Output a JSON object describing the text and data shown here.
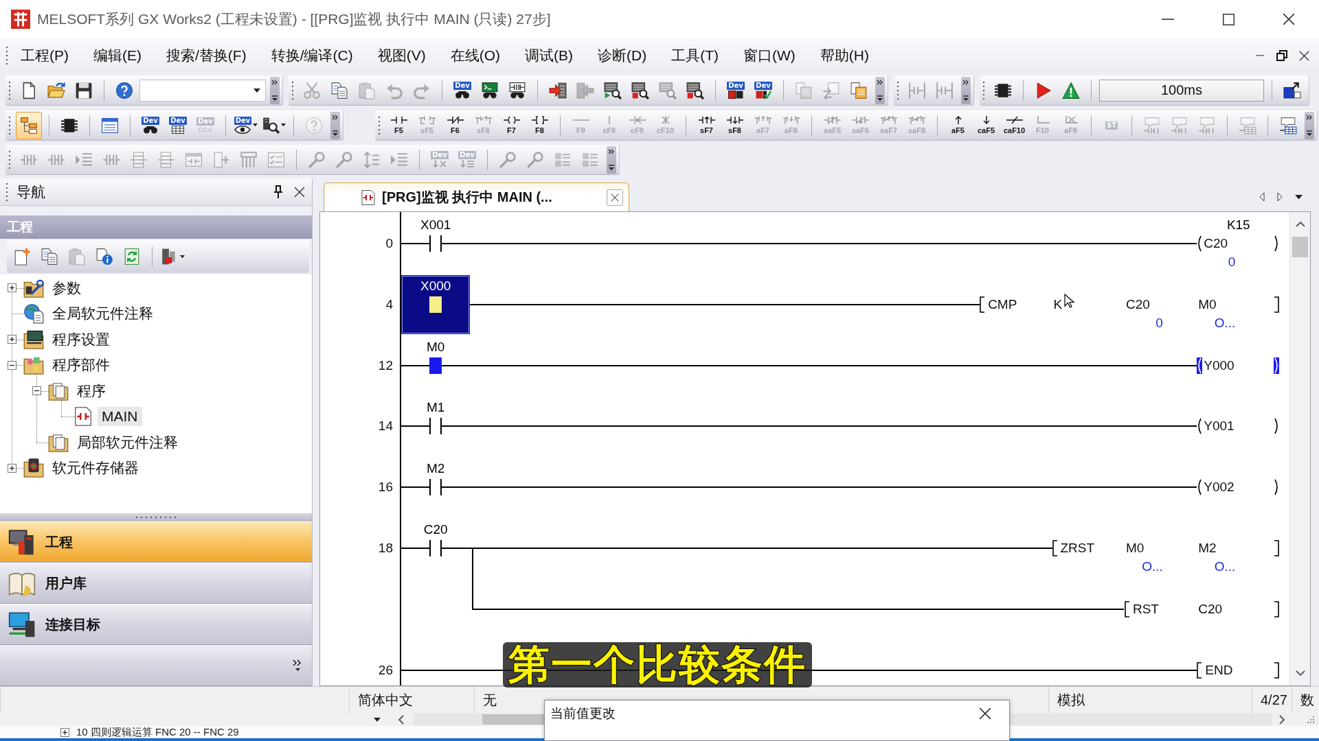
{
  "window": {
    "title": "MELSOFT系列 GX Works2 (工程未设置) - [[PRG]监视 执行中 MAIN (只读) 27步]"
  },
  "menu": {
    "items": [
      "工程(P)",
      "编辑(E)",
      "搜索/替换(F)",
      "转换/编译(C)",
      "视图(V)",
      "在线(O)",
      "调试(B)",
      "诊断(D)",
      "工具(T)",
      "窗口(W)",
      "帮助(H)"
    ]
  },
  "toolbar_rows": [
    [
      {
        "overflow": true,
        "groups": [
          [
            {
              "kind": "button",
              "disabled": false
            },
            {
              "kind": "button",
              "disabled": false
            },
            {
              "kind": "button",
              "disabled": false
            }
          ],
          [
            {
              "kind": "button",
              "disabled": false
            },
            {
              "kind": "combo"
            }
          ]
        ]
      },
      {
        "overflow": true,
        "groups": [
          [
            {
              "kind": "button",
              "disabled": true
            },
            {
              "kind": "button",
              "disabled": false
            },
            {
              "kind": "button",
              "disabled": true
            },
            {
              "kind": "button",
              "disabled": true
            },
            {
              "kind": "button",
              "disabled": true
            }
          ],
          [
            {
              "kind": "button",
              "label": "Dev",
              "disabled": false
            },
            {
              "kind": "button",
              "disabled": false
            },
            {
              "kind": "button",
              "disabled": false
            }
          ],
          [
            {
              "kind": "button",
              "disabled": false
            },
            {
              "kind": "button",
              "disabled": true
            },
            {
              "kind": "button",
              "disabled": false
            },
            {
              "kind": "button",
              "disabled": false
            },
            {
              "kind": "button",
              "disabled": true
            },
            {
              "kind": "button",
              "disabled": false
            }
          ],
          [
            {
              "kind": "button",
              "label": "Dev",
              "disabled": false
            },
            {
              "kind": "button",
              "label": "Dev",
              "disabled": false
            }
          ],
          [
            {
              "kind": "button",
              "disabled": true
            },
            {
              "kind": "button",
              "disabled": true
            },
            {
              "kind": "button",
              "disabled": false
            }
          ]
        ]
      },
      {
        "overflow": true,
        "groups": [
          [
            {
              "kind": "button",
              "disabled": true
            },
            {
              "kind": "button",
              "disabled": true
            }
          ]
        ]
      },
      {
        "overflow": false,
        "groups": [
          [
            {
              "kind": "button",
              "disabled": false
            }
          ],
          [
            {
              "kind": "button",
              "disabled": false
            },
            {
              "kind": "button",
              "disabled": false
            }
          ],
          [
            {
              "kind": "field",
              "value": "100ms"
            }
          ],
          [
            {
              "kind": "button",
              "disabled": false
            }
          ]
        ]
      }
    ],
    [
      {
        "overflow": true,
        "groups": [
          [
            {
              "kind": "button",
              "disabled": false,
              "pressed": true
            }
          ],
          [
            {
              "kind": "button",
              "disabled": false
            }
          ],
          [
            {
              "kind": "button",
              "disabled": false
            }
          ],
          [
            {
              "kind": "button",
              "label": "Dev",
              "disabled": false
            },
            {
              "kind": "button",
              "label": "Dev",
              "disabled": false
            },
            {
              "kind": "button",
              "label": "Dev",
              "sublabel": "CC-L",
              "disabled": true
            }
          ],
          [
            {
              "kind": "dropdown",
              "label": "Dev",
              "disabled": false
            },
            {
              "kind": "dropdown",
              "disabled": false
            }
          ],
          [
            {
              "kind": "button",
              "disabled": true
            }
          ]
        ]
      },
      {
        "overflow": true,
        "groups": [
          [
            {
              "kind": "key",
              "label": "F5",
              "disabled": false
            },
            {
              "kind": "key",
              "label": "sF5",
              "disabled": true
            },
            {
              "kind": "key",
              "label": "F6",
              "disabled": false
            },
            {
              "kind": "key",
              "label": "sF6",
              "disabled": true
            },
            {
              "kind": "key",
              "label": "F7",
              "disabled": false
            },
            {
              "kind": "key",
              "label": "F8",
              "disabled": false
            }
          ],
          [
            {
              "kind": "key",
              "label": "F9",
              "disabled": true
            },
            {
              "kind": "key",
              "label": "sF9",
              "disabled": true
            },
            {
              "kind": "key",
              "label": "cF9",
              "disabled": true
            },
            {
              "kind": "key",
              "label": "cF10",
              "disabled": true
            }
          ],
          [
            {
              "kind": "key",
              "label": "sF7",
              "disabled": false
            },
            {
              "kind": "key",
              "label": "sF8",
              "disabled": false
            },
            {
              "kind": "key",
              "label": "aF7",
              "disabled": true
            },
            {
              "kind": "key",
              "label": "aF8",
              "disabled": true
            }
          ],
          [
            {
              "kind": "key",
              "label": "saF5",
              "disabled": true
            },
            {
              "kind": "key",
              "label": "saF6",
              "disabled": true
            },
            {
              "kind": "key",
              "label": "saF7",
              "disabled": true
            },
            {
              "kind": "key",
              "label": "saF8",
              "disabled": true
            }
          ],
          [
            {
              "kind": "key",
              "label": "aF5",
              "disabled": false
            },
            {
              "kind": "key",
              "label": "caF5",
              "disabled": false
            },
            {
              "kind": "key",
              "label": "caF10",
              "disabled": false
            },
            {
              "kind": "key",
              "label": "F10",
              "disabled": true
            },
            {
              "kind": "key",
              "label": "aF9",
              "disabled": true
            }
          ],
          [
            {
              "kind": "button",
              "label": "ST",
              "disabled": true
            }
          ],
          [
            {
              "kind": "button",
              "disabled": true
            },
            {
              "kind": "button",
              "disabled": true
            },
            {
              "kind": "button",
              "disabled": true
            }
          ],
          [
            {
              "kind": "button",
              "disabled": true
            }
          ],
          [
            {
              "kind": "button",
              "disabled": false
            }
          ]
        ]
      }
    ],
    [
      {
        "overflow": true,
        "groups": [
          [
            {
              "kind": "button",
              "disabled": true
            },
            {
              "kind": "button",
              "disabled": true
            },
            {
              "kind": "button",
              "disabled": true
            },
            {
              "kind": "button",
              "disabled": true
            },
            {
              "kind": "button",
              "disabled": true
            },
            {
              "kind": "button",
              "disabled": true
            },
            {
              "kind": "button",
              "disabled": true
            },
            {
              "kind": "button",
              "disabled": true
            },
            {
              "kind": "button",
              "disabled": true
            },
            {
              "kind": "button",
              "disabled": true
            }
          ],
          [
            {
              "kind": "button",
              "disabled": true
            },
            {
              "kind": "button",
              "disabled": true
            },
            {
              "kind": "button",
              "disabled": true
            },
            {
              "kind": "button",
              "disabled": true
            }
          ],
          [
            {
              "kind": "button",
              "label": "Dev",
              "disabled": true
            },
            {
              "kind": "button",
              "label": "Dev",
              "disabled": true
            }
          ],
          [
            {
              "kind": "button",
              "disabled": true
            },
            {
              "kind": "button",
              "disabled": true
            },
            {
              "kind": "button",
              "disabled": true
            },
            {
              "kind": "button",
              "disabled": true
            }
          ]
        ]
      }
    ]
  ],
  "navigation": {
    "title": "导航",
    "section": "工程",
    "toolbar": [
      [
        {
          "kind": "button",
          "disabled": false
        },
        {
          "kind": "button",
          "disabled": false
        },
        {
          "kind": "button",
          "disabled": true
        },
        {
          "kind": "button",
          "disabled": false
        },
        {
          "kind": "button",
          "disabled": false
        }
      ],
      [
        {
          "kind": "dropdown",
          "disabled": false
        }
      ]
    ],
    "tree": [
      {
        "kind": "branch",
        "label": "参数",
        "expanded": false,
        "selected": false
      },
      {
        "kind": "leaf",
        "label": "全局软元件注释",
        "selected": false
      },
      {
        "kind": "branch",
        "label": "程序设置",
        "expanded": false,
        "selected": false
      },
      {
        "kind": "branch",
        "label": "程序部件",
        "expanded": true,
        "selected": false,
        "children": [
          {
            "kind": "branch",
            "label": "程序",
            "expanded": true,
            "selected": false,
            "children": [
              {
                "kind": "leaf",
                "label": "MAIN",
                "selected": true
              }
            ]
          },
          {
            "kind": "leaf",
            "label": "局部软元件注释",
            "selected": false
          }
        ]
      },
      {
        "kind": "branch",
        "label": "软元件存储器",
        "expanded": false,
        "selected": false
      }
    ],
    "views": [
      {
        "label": "工程",
        "selected": true
      },
      {
        "label": "用户库",
        "selected": false
      },
      {
        "label": "连接目标",
        "selected": false
      }
    ]
  },
  "editor": {
    "tabs": [
      {
        "title": "[PRG]监视 执行中 MAIN (...",
        "selected": true
      }
    ],
    "ladder": {
      "rungs": [
        {
          "step": "0",
          "rows": [
            {
              "kind": "main",
              "contacts": [
                {
                  "device": "X001",
                  "on": false,
                  "selected": false
                }
              ],
              "output": {
                "kind": "coil",
                "device": "C20",
                "on": false,
                "preset": "K15",
                "value": "0"
              }
            }
          ]
        },
        {
          "step": "4",
          "rows": [
            {
              "kind": "main",
              "contacts": [
                {
                  "device": "X000",
                  "on": true,
                  "selected": true
                }
              ],
              "output": {
                "kind": "instruction",
                "name": "CMP",
                "operands": [
                  {
                    "device": "K"
                  },
                  {
                    "device": "C20",
                    "value": "0"
                  },
                  {
                    "device": "M0",
                    "value": "O..."
                  }
                ]
              }
            }
          ]
        },
        {
          "step": "12",
          "rows": [
            {
              "kind": "main",
              "contacts": [
                {
                  "device": "M0",
                  "on": true,
                  "selected": false
                }
              ],
              "output": {
                "kind": "coil",
                "device": "Y000",
                "on": true
              }
            }
          ]
        },
        {
          "step": "14",
          "rows": [
            {
              "kind": "main",
              "contacts": [
                {
                  "device": "M1",
                  "on": false,
                  "selected": false
                }
              ],
              "output": {
                "kind": "coil",
                "device": "Y001",
                "on": false
              }
            }
          ]
        },
        {
          "step": "16",
          "rows": [
            {
              "kind": "main",
              "contacts": [
                {
                  "device": "M2",
                  "on": false,
                  "selected": false
                }
              ],
              "output": {
                "kind": "coil",
                "device": "Y002",
                "on": false
              }
            }
          ]
        },
        {
          "step": "18",
          "rows": [
            {
              "kind": "main",
              "contacts": [
                {
                  "device": "C20",
                  "on": false,
                  "selected": false
                }
              ],
              "output": {
                "kind": "instruction",
                "name": "ZRST",
                "operands": [
                  {
                    "device": "M0",
                    "value": "O..."
                  },
                  {
                    "device": "M2",
                    "value": "O..."
                  }
                ]
              }
            },
            {
              "kind": "branch",
              "output": {
                "kind": "instruction",
                "name": "RST",
                "operands": [
                  {
                    "device": "C20"
                  }
                ]
              }
            }
          ]
        },
        {
          "step": "26",
          "rows": [
            {
              "kind": "main",
              "output": {
                "kind": "instruction",
                "name": "END"
              }
            }
          ]
        }
      ]
    }
  },
  "status_bar": {
    "items": [
      "简体中文",
      "无",
      "模拟",
      "4/27",
      "数"
    ]
  },
  "popup": {
    "title": "当前值更改"
  },
  "subtitle": "第一个比较条件",
  "lower_window": {
    "row": "10 四则逻辑运算 FNC 20 -- FNC 29"
  }
}
